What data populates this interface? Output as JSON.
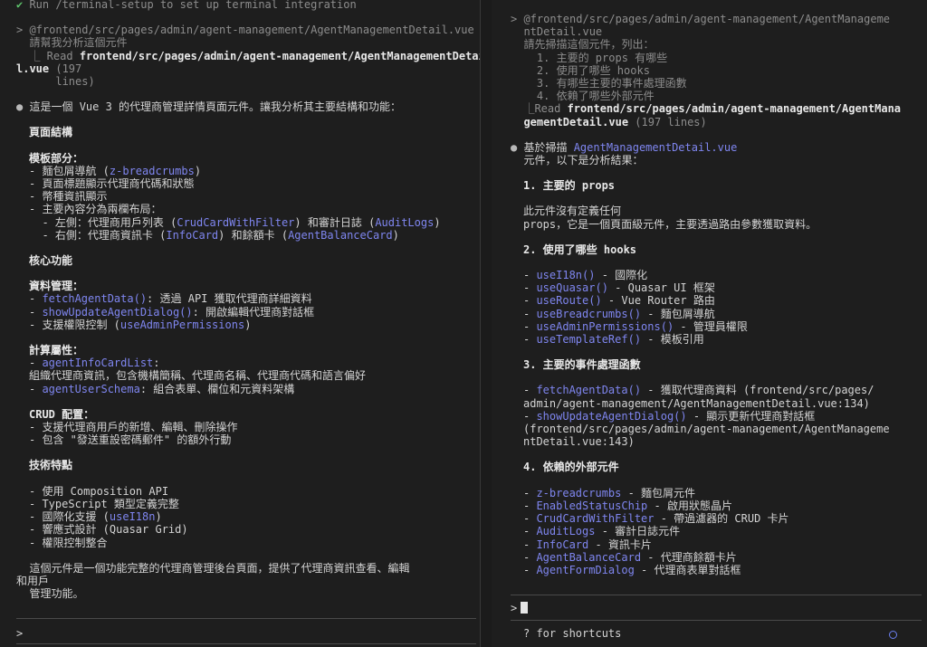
{
  "left": {
    "setup_hint": "✔ Run /terminal-setup to set up terminal integration",
    "user_path": "> @frontend/src/pages/admin/agent-management/AgentManagementDetail.vue",
    "user_msg": "  請幫我分析這個元件",
    "read_prefix": "  ⎿ Read ",
    "read_file_a": "frontend/src/pages/admin/agent-management/AgentManagementDetai",
    "read_file_b": "l.vue",
    "read_count_a": " (197",
    "read_count_b": "      lines)",
    "intro": "這是一個 Vue 3 的代理商管理詳情頁面元件。讓我分析其主要結構和功能：",
    "h_structure": "頁面結構",
    "h_template": "模板部分：",
    "t1_a": "- 麵包屑導航 (",
    "t1_l": "z-breadcrumbs",
    "t1_b": ")",
    "t2": "- 頁面標題顯示代理商代碼和狀態",
    "t3": "- 幣種資訊顯示",
    "t4": "- 主要內容分為兩欄布局：",
    "t5_a": "  - 左側：代理商用戶列表 (",
    "t5_l1": "CrudCardWithFilter",
    "t5_b": ") 和審計日誌 (",
    "t5_l2": "AuditLogs",
    "t5_c": ")",
    "t6_a": "  - 右側：代理商資訊卡 (",
    "t6_l1": "InfoCard",
    "t6_b": ") 和餘額卡 (",
    "t6_l2": "AgentBalanceCard",
    "t6_c": ")",
    "h_core": "核心功能",
    "h_data": "資料管理：",
    "d1_l": "fetchAgentData()",
    "d1_b": ": 透過 API 獲取代理商詳細資料",
    "d2_l": "showUpdateAgentDialog()",
    "d2_b": ": 開啟編輯代理商對話框",
    "d3_a": "- 支援權限控制 (",
    "d3_l": "useAdminPermissions",
    "d3_b": ")",
    "h_computed": "計算屬性：",
    "c1_l": "agentInfoCardList",
    "c1_b": ":",
    "c1_desc": "組織代理商資訊，包含機構簡稱、代理商名稱、代理商代碼和語言偏好",
    "c2_l": "agentUserSchema",
    "c2_b": ": 組合表單、欄位和元資料架構",
    "h_crud": "CRUD 配置：",
    "r1": "- 支援代理商用戶的新增、編輯、刪除操作",
    "r2": "- 包含 \"發送重設密碼郵件\" 的額外行動",
    "h_tech": "技術特點",
    "k1": "- 使用 Composition API",
    "k2": "- TypeScript 類型定義完整",
    "k3_a": "- 國際化支援 (",
    "k3_l": "useI18n",
    "k3_b": ")",
    "k4": "- 響應式設計 (Quasar Grid)",
    "k5": "- 權限控制整合",
    "summary_a": "  這個元件是一個功能完整的代理商管理後台頁面，提供了代理商資訊查看、編輯",
    "summary_b": "和用戶",
    "summary_c": "  管理功能。",
    "prompt": ">"
  },
  "right": {
    "path_a": "> @frontend/src/pages/admin/agent-management/AgentManageme",
    "path_b": "  ntDetail.vue",
    "ask0": "  請先掃描這個元件，列出：",
    "ask1": "    1. 主要的 props 有哪些",
    "ask2": "    2. 使用了哪些 hooks",
    "ask3": "    3. 有哪些主要的事件處理函數",
    "ask4": "    4. 依賴了哪些外部元件",
    "read_prefix": "  ⎿Read ",
    "read_file_a": "frontend/src/pages/admin/agent-management/AgentMana",
    "read_file_b": "gementDetail.vue",
    "read_count": " (197 lines)",
    "intro_a": "基於掃描 ",
    "intro_l": "AgentManagementDetail.vue",
    "intro_b": "  元件，以下是分析結果：",
    "h1": "1. 主要的 props",
    "p1": "此元件沒有定義任何",
    "p2": "props，它是一個頁面級元件，主要透過路由參數獲取資料。",
    "h2": "2. 使用了哪些 hooks",
    "hooks": [
      {
        "name": "useI18n()",
        "desc": " - 國際化"
      },
      {
        "name": "useQuasar()",
        "desc": " - Quasar UI 框架"
      },
      {
        "name": "useRoute()",
        "desc": " - Vue Router 路由"
      },
      {
        "name": "useBreadcrumbs()",
        "desc": " - 麵包屑導航"
      },
      {
        "name": "useAdminPermissions()",
        "desc": " - 管理員權限"
      },
      {
        "name": "useTemplateRef()",
        "desc": " - 模板引用"
      }
    ],
    "h3": "3. 主要的事件處理函數",
    "e1_l": "fetchAgentData()",
    "e1_b": " - 獲取代理商資料 (frontend/src/pages/",
    "e1_c": "admin/agent-management/AgentManagementDetail.vue:134)",
    "e2_l": "showUpdateAgentDialog()",
    "e2_b": " - 顯示更新代理商對話框",
    "e2_c": "(frontend/src/pages/admin/agent-management/AgentManageme",
    "e2_d": "ntDetail.vue:143)",
    "h4": "4. 依賴的外部元件",
    "deps": [
      {
        "name": "z-breadcrumbs",
        "desc": " - 麵包屑元件"
      },
      {
        "name": "EnabledStatusChip",
        "desc": " - 啟用狀態晶片"
      },
      {
        "name": "CrudCardWithFilter",
        "desc": " - 帶過濾器的 CRUD 卡片"
      },
      {
        "name": "AuditLogs",
        "desc": " - 審計日誌元件"
      },
      {
        "name": "InfoCard",
        "desc": " - 資訊卡片"
      },
      {
        "name": "AgentBalanceCard",
        "desc": " - 代理商餘額卡片"
      },
      {
        "name": "AgentFormDialog",
        "desc": " - 代理商表單對話框"
      }
    ],
    "prompt": ">",
    "shortcuts": "? for shortcuts"
  },
  "colors": {
    "bg": "#1e1e1e",
    "link": "#7f86f0",
    "check": "#5ec46c",
    "status_dot": "#6b7ff0"
  }
}
